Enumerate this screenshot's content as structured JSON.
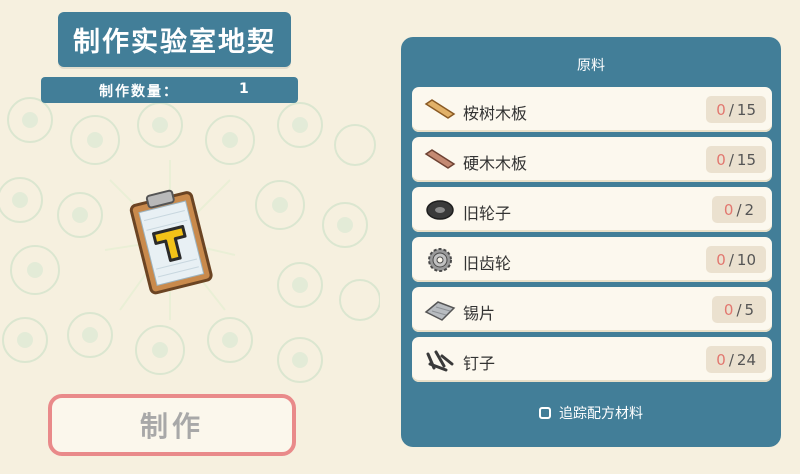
{
  "header": {
    "title": "制作实验室地契"
  },
  "quantity": {
    "label": "制作数量：",
    "value": "1"
  },
  "make_button": {
    "label": "制作"
  },
  "materials_panel": {
    "title": "原料",
    "items": [
      {
        "name": "桉树木板",
        "have": "0",
        "need": "15",
        "icon": "plank-light-icon"
      },
      {
        "name": "硬木木板",
        "have": "0",
        "need": "15",
        "icon": "plank-dark-icon"
      },
      {
        "name": "旧轮子",
        "have": "0",
        "need": "2",
        "icon": "wheel-icon"
      },
      {
        "name": "旧齿轮",
        "have": "0",
        "need": "10",
        "icon": "gear-icon"
      },
      {
        "name": "锡片",
        "have": "0",
        "need": "5",
        "icon": "tin-sheet-icon"
      },
      {
        "name": "钉子",
        "have": "0",
        "need": "24",
        "icon": "nails-icon"
      }
    ],
    "track_label": "追踪配方材料",
    "track_checked": false
  },
  "colors": {
    "accent": "#427e98",
    "background": "#f6f0df",
    "have_count": "#e2776f",
    "button_border": "#e98a8a"
  }
}
